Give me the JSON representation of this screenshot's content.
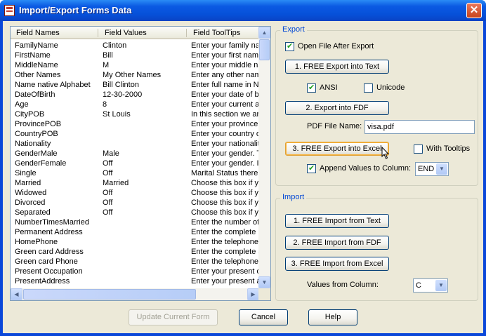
{
  "window": {
    "title": "Import/Export Forms Data",
    "close_glyph": "✕"
  },
  "list": {
    "columns": [
      "Field Names",
      "Field Values",
      "Field ToolTips"
    ],
    "rows": [
      {
        "name": "FamilyName",
        "value": "Clinton",
        "tip": "Enter your family nam"
      },
      {
        "name": "FirstName",
        "value": "Bill",
        "tip": "Enter your first name"
      },
      {
        "name": "MiddleName",
        "value": "M",
        "tip": "Enter your middle nar"
      },
      {
        "name": "Other Names",
        "value": "My Other Names",
        "tip": "Enter any other nam"
      },
      {
        "name": "Name native Alphabet",
        "value": "Bill Clinton",
        "tip": "Enter full name in Na"
      },
      {
        "name": "DateOfBirth",
        "value": "12-30-2000",
        "tip": "Enter your date of bi"
      },
      {
        "name": "Age",
        "value": "8",
        "tip": "Enter your current ag"
      },
      {
        "name": "CityPOB",
        "value": "St Louis",
        "tip": "In this section we ar"
      },
      {
        "name": "ProvincePOB",
        "value": "",
        "tip": "Enter your province"
      },
      {
        "name": "CountryPOB",
        "value": "",
        "tip": "Enter your country o"
      },
      {
        "name": "Nationality",
        "value": "",
        "tip": "Enter your nationality"
      },
      {
        "name": "GenderMale",
        "value": "Male",
        "tip": "Enter your gender. T"
      },
      {
        "name": "GenderFemale",
        "value": "Off",
        "tip": "Enter your gender. I"
      },
      {
        "name": "Single",
        "value": "Off",
        "tip": "Marital Status there"
      },
      {
        "name": "Married",
        "value": "Married",
        "tip": "Choose this box if yo"
      },
      {
        "name": "Widowed",
        "value": "Off",
        "tip": "Choose this box if yo"
      },
      {
        "name": "Divorced",
        "value": "Off",
        "tip": "Choose this box if yo"
      },
      {
        "name": "Separated",
        "value": "Off",
        "tip": "Choose this box if yo"
      },
      {
        "name": "NumberTimesMarried",
        "value": "",
        "tip": "Enter the number of"
      },
      {
        "name": "Permanent Address",
        "value": "",
        "tip": "Enter the complete p"
      },
      {
        "name": "HomePhone",
        "value": "",
        "tip": "Enter the telephone"
      },
      {
        "name": "Green card Address",
        "value": "",
        "tip": "Enter the complete a"
      },
      {
        "name": "Green card Phone",
        "value": "",
        "tip": "Enter the telephone"
      },
      {
        "name": "Present Occupation",
        "value": "",
        "tip": "Enter your present o"
      },
      {
        "name": "PresentAddress",
        "value": "",
        "tip": "Enter your present a"
      }
    ]
  },
  "export": {
    "group_label": "Export",
    "open_after_label": "Open File After Export",
    "open_after_checked": true,
    "text_button": "1. FREE Export into Text",
    "ansi_label": "ANSI",
    "ansi_checked": true,
    "unicode_label": "Unicode",
    "unicode_checked": false,
    "fdf_button": "2. Export into FDF",
    "pdf_name_label": "PDF File Name:",
    "pdf_name_value": "visa.pdf",
    "excel_button": "3. FREE Export into Excel",
    "tooltips_label": "With Tooltips",
    "tooltips_checked": false,
    "append_label": "Append Values to Column:",
    "append_checked": true,
    "append_column": "END"
  },
  "import": {
    "group_label": "Import",
    "text_button": "1. FREE Import from Text",
    "fdf_button": "2. FREE Import from FDF",
    "excel_button": "3. FREE Import from Excel",
    "column_label": "Values from Column:",
    "column_value": "C"
  },
  "footer": {
    "update_button": "Update Current Form",
    "cancel_button": "Cancel",
    "help_button": "Help"
  }
}
